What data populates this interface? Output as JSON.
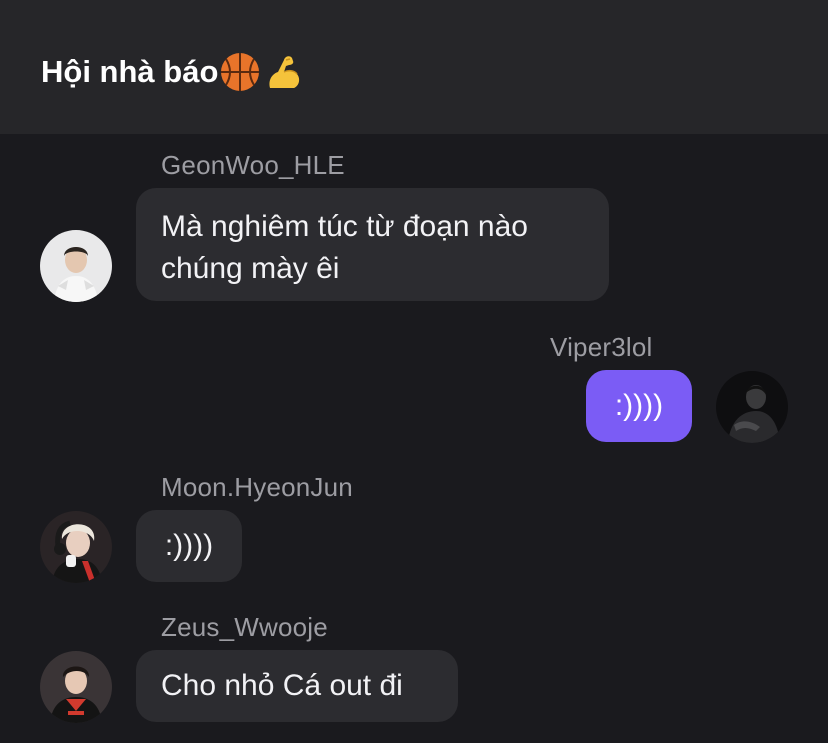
{
  "header": {
    "title": "Hội nhà báo",
    "emojis": [
      "basketball-emoji",
      "flexed-biceps-emoji"
    ]
  },
  "messages": [
    {
      "sender": "GeonWoo_HLE",
      "text": "Mà nghiêm túc từ đoạn nào chúng mày êi",
      "line1": "Mà nghiêm túc từ đoạn nào",
      "line2": "chúng mày êi",
      "side": "left"
    },
    {
      "sender": "Viper3lol",
      "text": ":))))",
      "side": "right"
    },
    {
      "sender": "Moon.HyeonJun",
      "text": ":))))",
      "side": "left"
    },
    {
      "sender": "Zeus_Wwooje",
      "text": "Cho nhỏ Cá out đi",
      "side": "left"
    }
  ],
  "colors": {
    "background": "#1a1a1e",
    "header": "#262629",
    "bubble_other": "#2c2c30",
    "bubble_mine": "#7b5cf5",
    "sender_name": "#9d9da3"
  }
}
